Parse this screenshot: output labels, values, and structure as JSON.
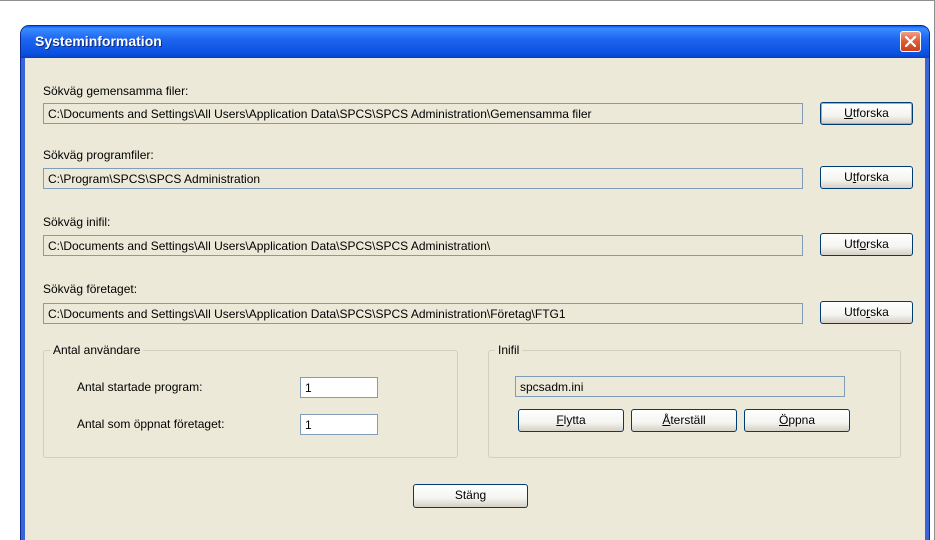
{
  "window": {
    "title": "Systeminformation"
  },
  "paths": [
    {
      "label": "Sökväg gemensamma filer:",
      "value": "C:\\Documents and Settings\\All Users\\Application Data\\SPCS\\SPCS Administration\\Gemensamma filer",
      "button": {
        "pre": "",
        "u": "U",
        "post": "tforska"
      }
    },
    {
      "label": "Sökväg programfiler:",
      "value": "C:\\Program\\SPCS\\SPCS Administration",
      "button": {
        "pre": "U",
        "u": "t",
        "post": "forska"
      }
    },
    {
      "label": "Sökväg inifil:",
      "value": "C:\\Documents and Settings\\All Users\\Application Data\\SPCS\\SPCS Administration\\",
      "button": {
        "pre": "Utf",
        "u": "o",
        "post": "rska"
      }
    },
    {
      "label": "Sökväg företaget:",
      "value": "C:\\Documents and Settings\\All Users\\Application Data\\SPCS\\SPCS Administration\\Företag\\FTG1",
      "button": {
        "pre": "Utfo",
        "u": "r",
        "post": "ska"
      }
    }
  ],
  "users": {
    "legend": "Antal användare",
    "started_label": "Antal startade program:",
    "started_value": "1",
    "opened_label": "Antal som öppnat företaget:",
    "opened_value": "1"
  },
  "inifile": {
    "legend": "Inifil",
    "value": "spcsadm.ini",
    "move": {
      "u": "F",
      "post": "lytta"
    },
    "reset": {
      "u": "Å",
      "post": "terställ"
    },
    "open": {
      "u": "Ö",
      "post": "ppna"
    }
  },
  "close_button": {
    "label": "Stäng"
  }
}
